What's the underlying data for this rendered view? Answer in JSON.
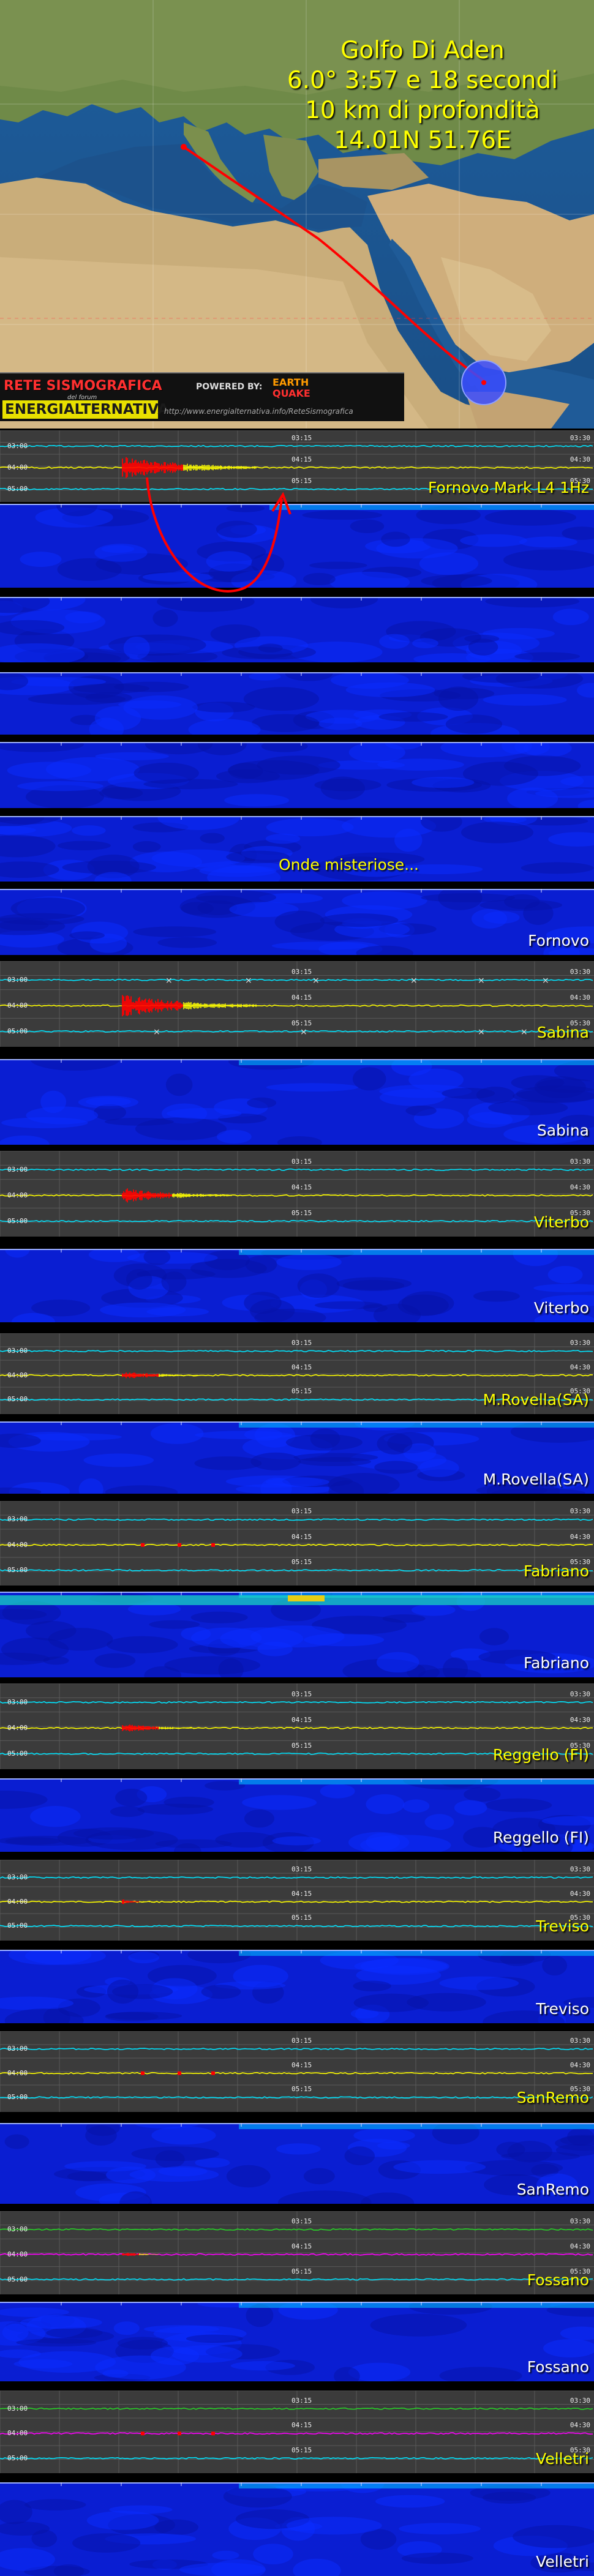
{
  "title": {
    "line1": "Golfo Di Aden",
    "line2": "6.0° 3:57 e 18 secondi",
    "line3": "10 km di profondità",
    "line4": "14.01N 51.76E"
  },
  "logo": {
    "rete": "RETE SISMOGRAFICA",
    "forum": "del forum",
    "energialternativa": "ENERGIALTERNATIVA",
    "powered_by": "POWERED BY:",
    "earth": "EARTH",
    "quake": "QUAKE",
    "url": "http://www.energialternativa.info/ReteSismografica"
  },
  "time_labels": {
    "left": [
      "03:00",
      "04:00",
      "05:00"
    ],
    "center": [
      "03:15",
      "04:15",
      "05:15"
    ],
    "right": [
      "03:30",
      "04:30",
      "05:30"
    ]
  },
  "annotation": "Onde misteriose...",
  "stations": [
    {
      "name": "Fornovo Mark L4 1Hz",
      "seismo": "Fornovo Mark L4 1Hz",
      "spectro": "Fornovo"
    },
    {
      "name": "Sabina",
      "seismo": "Sabina",
      "spectro": "Sabina"
    },
    {
      "name": "Viterbo",
      "seismo": "Viterbo",
      "spectro": "Viterbo"
    },
    {
      "name": "M.Rovella(SA)",
      "seismo": "M.Rovella(SA)",
      "spectro": "M.Rovella(SA)"
    },
    {
      "name": "Fabriano",
      "seismo": "Fabriano",
      "spectro": "Fabriano"
    },
    {
      "name": "Reggello (FI)",
      "seismo": "Reggello (FI)",
      "spectro": "Reggello (FI)"
    },
    {
      "name": "Treviso",
      "seismo": "Treviso",
      "spectro": "Treviso"
    },
    {
      "name": "SanRemo",
      "seismo": "SanRemo",
      "spectro": "SanRemo"
    },
    {
      "name": "Fossano",
      "seismo": "Fossano",
      "spectro": "Fossano"
    },
    {
      "name": "Velletri",
      "seismo": "Velletri",
      "spectro": "Velletri"
    }
  ],
  "colors": {
    "title": "#ffff00",
    "trace_cyan": "#00e5ff",
    "trace_yellow": "#ffff00",
    "trace_magenta": "#ff00ff",
    "event_red": "#ff0000",
    "spectrogram_blue": "#0a1ed2",
    "epicenter": "#3a4cff"
  }
}
